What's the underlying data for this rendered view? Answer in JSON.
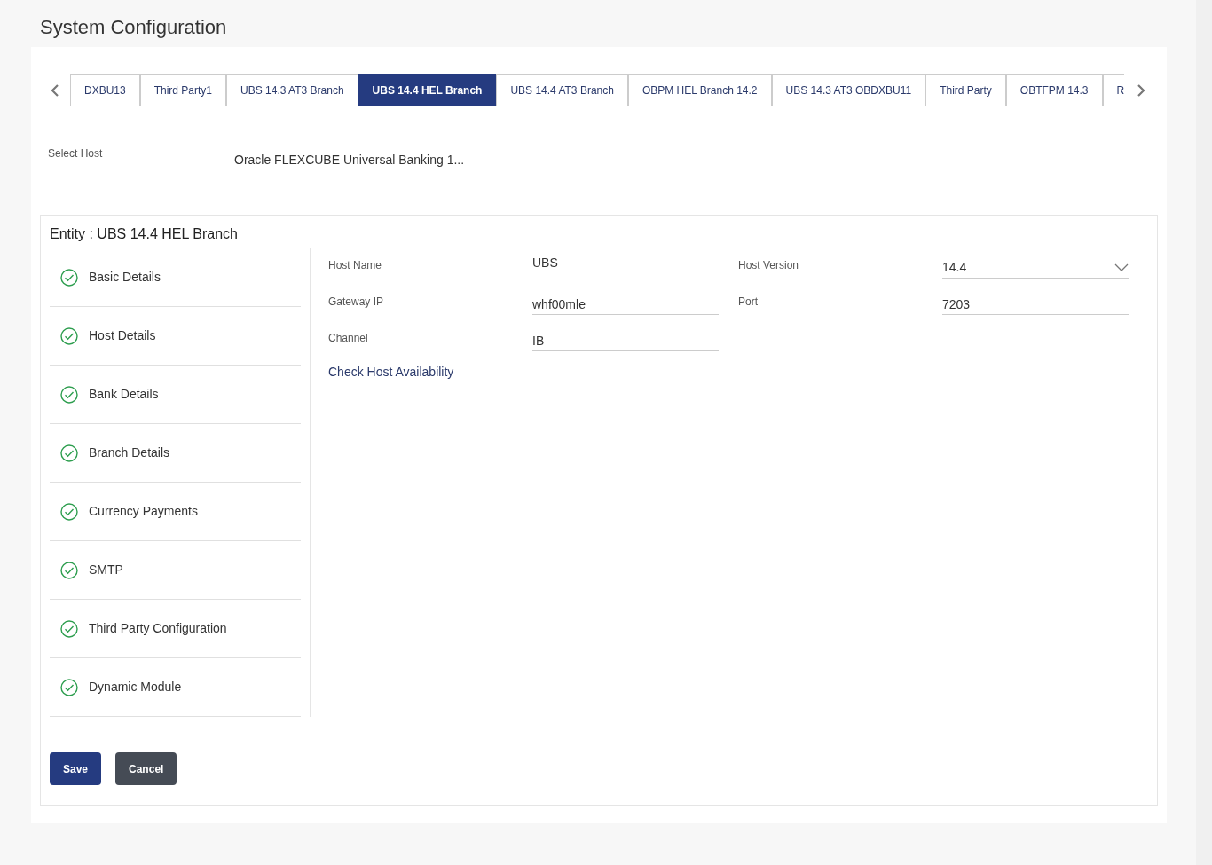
{
  "page_title": "System Configuration",
  "tabs": [
    {
      "label": "DXBU13",
      "selected": false
    },
    {
      "label": "Third Party1",
      "selected": false
    },
    {
      "label": "UBS 14.3 AT3 Branch",
      "selected": false
    },
    {
      "label": "UBS 14.4 HEL Branch",
      "selected": true
    },
    {
      "label": "UBS 14.4 AT3 Branch",
      "selected": false
    },
    {
      "label": "OBPM HEL Branch 14.2",
      "selected": false
    },
    {
      "label": "UBS 14.3 AT3 OBDXBU11",
      "selected": false
    },
    {
      "label": "Third Party",
      "selected": false
    },
    {
      "label": "OBTFPM 14.3",
      "selected": false
    },
    {
      "label": "R",
      "selected": false
    }
  ],
  "select_host": {
    "label": "Select Host",
    "value": "Oracle FLEXCUBE Universal Banking 1..."
  },
  "entity_title": "Entity : UBS 14.4 HEL Branch",
  "steps": [
    {
      "label": "Basic Details",
      "done": true
    },
    {
      "label": "Host Details",
      "done": true
    },
    {
      "label": "Bank Details",
      "done": true
    },
    {
      "label": "Branch Details",
      "done": true
    },
    {
      "label": "Currency Payments",
      "done": true
    },
    {
      "label": "SMTP",
      "done": true
    },
    {
      "label": "Third Party Configuration",
      "done": true
    },
    {
      "label": "Dynamic Module",
      "done": true
    }
  ],
  "field_rows": [
    [
      {
        "kind": "static",
        "label": "Host Name",
        "value": "UBS"
      },
      {
        "kind": "select",
        "label": "Host Version",
        "value": "14.4"
      }
    ],
    [
      {
        "kind": "input",
        "label": "Gateway IP",
        "value": "whf00mle"
      },
      {
        "kind": "input",
        "label": "Port",
        "value": "7203"
      }
    ],
    [
      {
        "kind": "input",
        "label": "Channel",
        "value": "IB"
      }
    ]
  ],
  "link": "Check Host Availability",
  "buttons": [
    {
      "kind": "primary",
      "label": "Save"
    },
    {
      "kind": "secondary",
      "label": "Cancel"
    }
  ]
}
